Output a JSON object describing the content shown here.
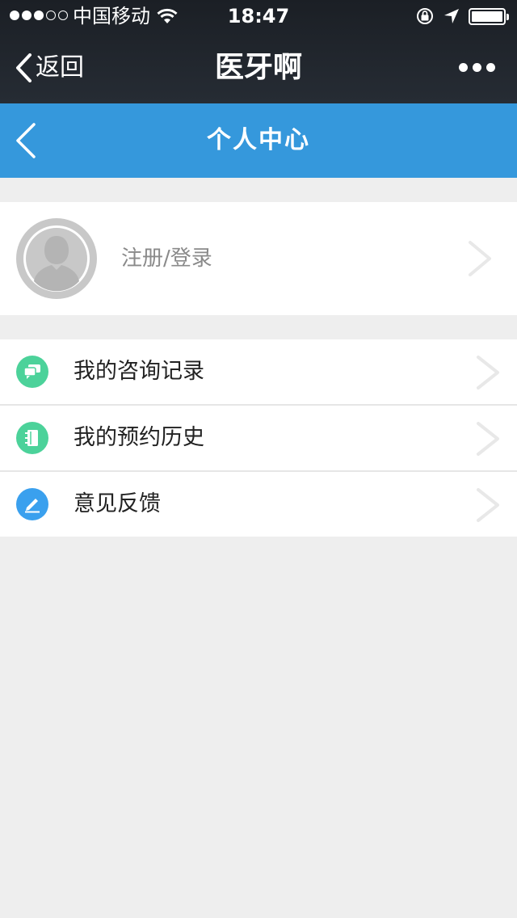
{
  "status_bar": {
    "carrier": "中国移动",
    "time": "18:47",
    "signal_bars_filled": 3,
    "signal_bars_total": 5
  },
  "wechat_nav": {
    "back_label": "返回",
    "title": "医牙啊"
  },
  "page_header": {
    "title": "个人中心"
  },
  "profile": {
    "login_label": "注册/登录"
  },
  "menu": {
    "items": [
      {
        "label": "我的咨询记录",
        "icon": "chat-icon",
        "color": "#4cd29a"
      },
      {
        "label": "我的预约历史",
        "icon": "notebook-icon",
        "color": "#4cd29a"
      },
      {
        "label": "意见反馈",
        "icon": "pencil-icon",
        "color": "#3aa0ee"
      }
    ]
  },
  "colors": {
    "header_blue": "#3598dc",
    "top_bar": "#1f242b",
    "background": "#eeeeee"
  }
}
